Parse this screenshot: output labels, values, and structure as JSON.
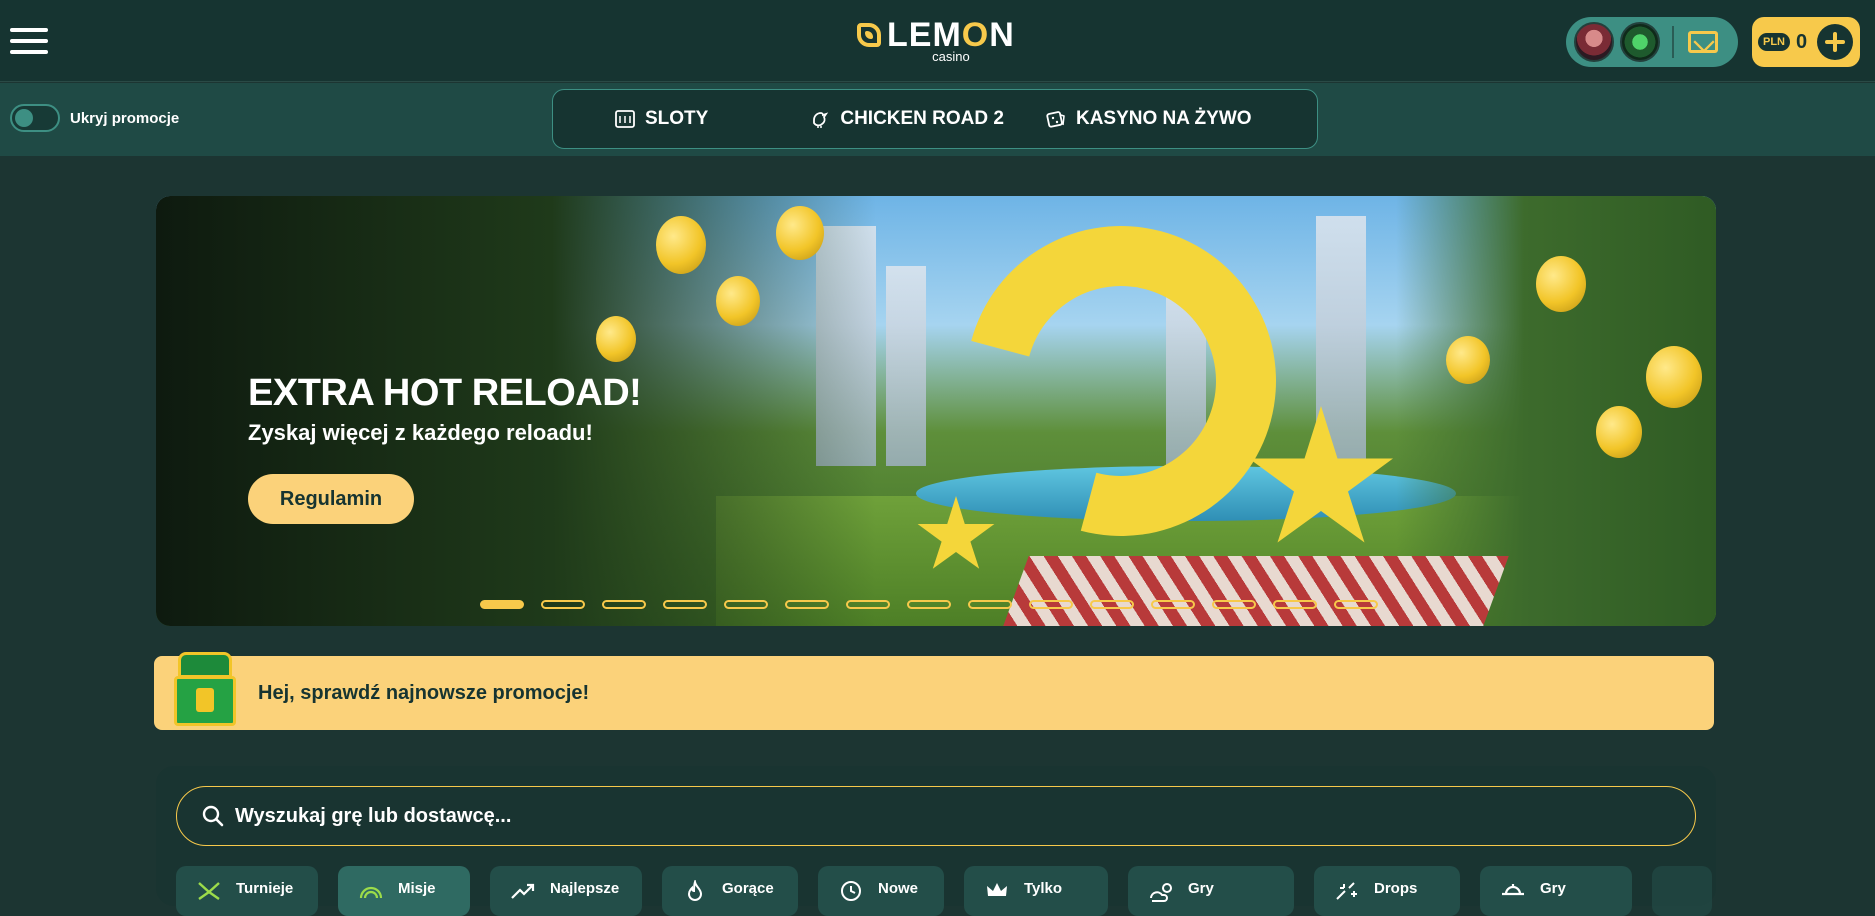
{
  "header": {
    "logo_text_lem": "LEM",
    "logo_text_o": "O",
    "logo_text_n": "N",
    "logo_sub": "casino",
    "balance": {
      "currency": "PLN",
      "amount": "0"
    }
  },
  "subnav": {
    "toggle_label": "Ukryj promocje",
    "tabs": [
      {
        "label": "SLOTY",
        "icon": "slots-icon"
      },
      {
        "label": "CHICKEN ROAD 2",
        "icon": "chicken-icon"
      },
      {
        "label": "KASYNO NA ŻYWO",
        "icon": "dice-icon"
      }
    ]
  },
  "banner": {
    "title": "EXTRA HOT RELOAD!",
    "subtitle": "Zyskaj więcej z każdego reloadu!",
    "button_label": "Regulamin",
    "slide_count": 15,
    "active_slide": 1
  },
  "promo": {
    "text": "Hej, sprawdź najnowsze promocje!"
  },
  "games": {
    "search_placeholder": "Wyszukaj grę lub dostawcę...",
    "categories": [
      {
        "label": "Turnieje",
        "icon": "tournament-icon"
      },
      {
        "label": "Misje",
        "icon": "missions-icon"
      },
      {
        "label": "Najlepsze",
        "icon": "trending-icon"
      },
      {
        "label": "Gorące",
        "icon": "fire-icon"
      },
      {
        "label": "Nowe",
        "icon": "clock-icon"
      },
      {
        "label": "Tylko",
        "icon": "crown-icon"
      },
      {
        "label": "Gry",
        "icon": "weather-icon"
      },
      {
        "label": "Drops",
        "icon": "drops-icon"
      },
      {
        "label": "Gry",
        "icon": "casino-icon"
      }
    ]
  },
  "colors": {
    "accent": "#f7c94b",
    "header_bg": "#163431",
    "subnav_bg": "#1f4a45",
    "teal": "#3d8f83",
    "promo_bg": "#fbd27a"
  }
}
